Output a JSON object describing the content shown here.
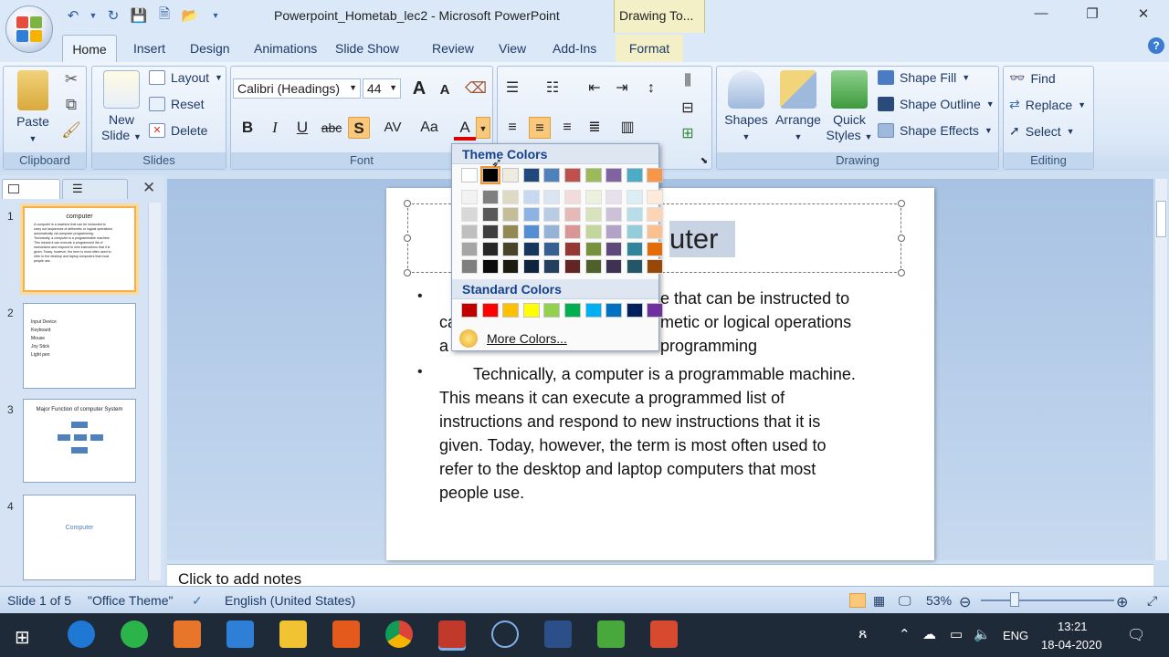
{
  "window": {
    "title": "Powerpoint_Hometab_lec2 - Microsoft PowerPoint",
    "context_tab": "Drawing To...",
    "controls": {
      "minimize": "—",
      "restore": "❐",
      "close": "✕"
    }
  },
  "tabs": [
    "Home",
    "Insert",
    "Design",
    "Animations",
    "Slide Show",
    "Review",
    "View",
    "Add-Ins",
    "Format"
  ],
  "ribbon": {
    "clipboard": {
      "label": "Clipboard",
      "paste": "Paste"
    },
    "slides": {
      "label": "Slides",
      "new_slide": "New",
      "new_slide2": "Slide",
      "layout": "Layout",
      "reset": "Reset",
      "delete": "Delete"
    },
    "font": {
      "label": "Font",
      "font_name": "Calibri (Headings)",
      "font_size": "44",
      "bold": "B",
      "italic": "I",
      "underline": "U",
      "strike": "abc",
      "shadow": "S",
      "spacing": "AV",
      "case": "Aa",
      "color": "A",
      "grow": "A",
      "shrink": "A"
    },
    "drawing": {
      "label": "Drawing",
      "shapes": "Shapes",
      "arrange": "Arrange",
      "quick1": "Quick",
      "quick2": "Styles",
      "fill": "Shape Fill",
      "outline": "Shape Outline",
      "effects": "Shape Effects"
    },
    "editing": {
      "label": "Editing",
      "find": "Find",
      "replace": "Replace",
      "select": "Select"
    }
  },
  "color_popup": {
    "theme_title": "Theme Colors",
    "standard_title": "Standard Colors",
    "more": "More Colors...",
    "theme_top": [
      "#ffffff",
      "#000000",
      "#eeece1",
      "#1f497d",
      "#4f81bd",
      "#c0504d",
      "#9bbb59",
      "#8064a2",
      "#4bacc6",
      "#f79646"
    ],
    "theme_shades": [
      [
        "#f2f2f2",
        "#d8d8d8",
        "#bfbfbf",
        "#a5a5a5",
        "#7f7f7f"
      ],
      [
        "#7f7f7f",
        "#595959",
        "#3f3f3f",
        "#262626",
        "#0c0c0c"
      ],
      [
        "#ddd9c3",
        "#c4bd97",
        "#938953",
        "#494429",
        "#1d1b10"
      ],
      [
        "#c6d9f0",
        "#8db3e2",
        "#548dd4",
        "#17365d",
        "#0f243e"
      ],
      [
        "#dbe5f1",
        "#b8cce4",
        "#95b3d7",
        "#366092",
        "#244061"
      ],
      [
        "#f2dcdb",
        "#e5b9b7",
        "#d99694",
        "#953734",
        "#632423"
      ],
      [
        "#ebf1dd",
        "#d7e3bc",
        "#c3d69b",
        "#76923c",
        "#4f6128"
      ],
      [
        "#e5e0ec",
        "#ccc1d9",
        "#b2a2c7",
        "#5f497a",
        "#3f3151"
      ],
      [
        "#dbeef3",
        "#b7dde8",
        "#92cddc",
        "#31859b",
        "#205867"
      ],
      [
        "#fdeada",
        "#fbd5b5",
        "#fac08f",
        "#e36c09",
        "#974806"
      ]
    ],
    "standard": [
      "#c00000",
      "#ff0000",
      "#ffc000",
      "#ffff00",
      "#92d050",
      "#00b050",
      "#00b0f0",
      "#0070c0",
      "#002060",
      "#7030a0"
    ]
  },
  "slides_pane": {
    "thumbs": [
      {
        "num": "1",
        "title": "computer",
        "lines": [
          "A computer is a machine that can be instructed to",
          "carry out sequences of arithmetic or logical operations",
          "automatically via computer programming.",
          "Technically, a computer is a programmable machine.",
          "This means it can execute a programmed list of",
          "instructions and respond to new instructions that it is",
          "given. Today, however, the term is most often used to",
          "refer to the desktop and laptop computers that most",
          "people use."
        ]
      },
      {
        "num": "2",
        "title": "",
        "lines": [
          "Input Device",
          "Keyboard",
          "Mouse",
          "Joy Stick",
          "Light pen"
        ]
      },
      {
        "num": "3",
        "title": "Major Function of computer System",
        "lines": []
      },
      {
        "num": "4",
        "title": "Computer",
        "lines": []
      }
    ]
  },
  "slide": {
    "title_visible": "uter",
    "bullet1_lines": [
      "e that can be instructed to",
      "ca",
      "metic or logical operations",
      "a",
      "programming"
    ],
    "bullet2_lines": [
      "Technically, a computer is a programmable machine.",
      "This means it can execute a programmed list of",
      "instructions and respond to new instructions that it is",
      "given. Today, however, the term is most often used to",
      "refer to the desktop and laptop computers that most",
      "people use."
    ]
  },
  "notes": "Click to add notes",
  "status": {
    "slide": "Slide 1 of 5",
    "theme": "\"Office Theme\"",
    "language": "English (United States)",
    "zoom": "53%"
  },
  "taskbar": {
    "lang": "ENG",
    "time": "13:21",
    "date": "18-04-2020"
  }
}
